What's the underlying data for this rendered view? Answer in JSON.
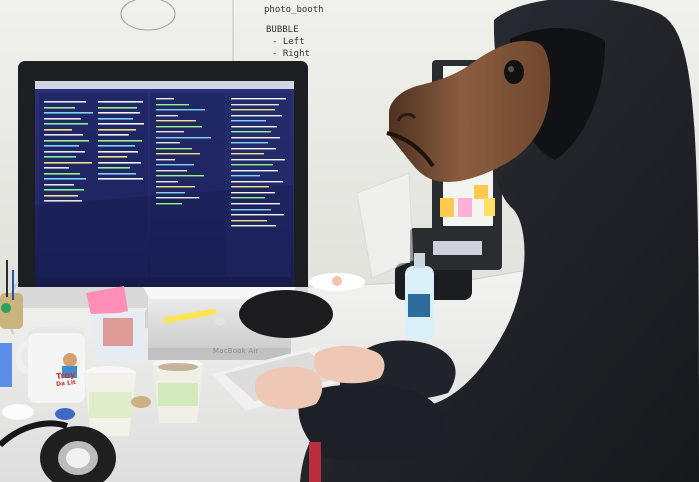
{
  "whiteboard": {
    "note_line_1": "photo_booth",
    "note_line_2": "BUBBLE",
    "note_line_3": "- Left",
    "note_line_4": "- Right"
  },
  "macbook_label": "MacBook Air",
  "mug": {
    "text_top": "Troy",
    "text_bottom": "Da Lit"
  },
  "colors": {
    "wall": "#e7e7e2",
    "desk": "#ededeb",
    "hoodie": "#24262b",
    "horse": "#7a4e34",
    "screen_bg": "#252a6f"
  }
}
